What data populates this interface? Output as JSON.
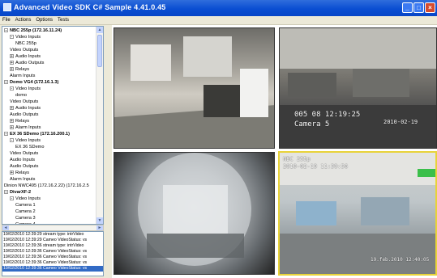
{
  "window": {
    "title": "Advanced Video SDK C# Sample  4.41.0.45",
    "minimize_symbol": "_",
    "maximize_symbol": "□",
    "close_symbol": "×"
  },
  "menu": [
    "File",
    "Actions",
    "Options",
    "Tests"
  ],
  "tree": [
    {
      "label": "NBC 255p (172.16.11.24)",
      "level": 0,
      "expander": "-",
      "bold": true
    },
    {
      "label": "Video Inputs",
      "level": 1,
      "expander": "-"
    },
    {
      "label": "NBC 255p",
      "level": 2,
      "expander": ""
    },
    {
      "label": "Video Outputs",
      "level": 1,
      "expander": ""
    },
    {
      "label": "Audio Inputs",
      "level": 1,
      "expander": "+"
    },
    {
      "label": "Audio Outputs",
      "level": 1,
      "expander": "+"
    },
    {
      "label": "Relays",
      "level": 1,
      "expander": "+"
    },
    {
      "label": "Alarm Inputs",
      "level": 1,
      "expander": ""
    },
    {
      "label": "Domo VG4 (172.16.1.3)",
      "level": 0,
      "expander": "-",
      "bold": true
    },
    {
      "label": "Video Inputs",
      "level": 1,
      "expander": "-"
    },
    {
      "label": "domo",
      "level": 2,
      "expander": ""
    },
    {
      "label": "Video Outputs",
      "level": 1,
      "expander": ""
    },
    {
      "label": "Audio Inputs",
      "level": 1,
      "expander": "+"
    },
    {
      "label": "Audio Outputs",
      "level": 1,
      "expander": ""
    },
    {
      "label": "Relays",
      "level": 1,
      "expander": "+"
    },
    {
      "label": "Alarm Inputs",
      "level": 1,
      "expander": "+"
    },
    {
      "label": "EX 36 SDemo (172.16.200.1)",
      "level": 0,
      "expander": "-",
      "bold": true
    },
    {
      "label": "Video Inputs",
      "level": 1,
      "expander": "-"
    },
    {
      "label": "EX 36 SDemo",
      "level": 2,
      "expander": ""
    },
    {
      "label": "Video Outputs",
      "level": 1,
      "expander": ""
    },
    {
      "label": "Audio Inputs",
      "level": 1,
      "expander": ""
    },
    {
      "label": "Audio Outputs",
      "level": 1,
      "expander": ""
    },
    {
      "label": "Relays",
      "level": 1,
      "expander": "+"
    },
    {
      "label": "Alarm Inputs",
      "level": 1,
      "expander": ""
    },
    {
      "label": "Dinion NWC495 (172.16.2.22) (172.16.2.5",
      "level": 0,
      "expander": ""
    },
    {
      "label": "DivarXF-2",
      "level": 0,
      "expander": "-",
      "bold": true
    },
    {
      "label": "Video Inputs",
      "level": 1,
      "expander": "-"
    },
    {
      "label": "Camera 1",
      "level": 2,
      "expander": ""
    },
    {
      "label": "Camera 2",
      "level": 2,
      "expander": ""
    },
    {
      "label": "Camera 3",
      "level": 2,
      "expander": ""
    },
    {
      "label": "Camera 4",
      "level": 2,
      "expander": ""
    }
  ],
  "log": [
    {
      "text": "19/02/2010 12:39:29 stream type: intrVideo",
      "selected": false
    },
    {
      "text": "19/02/2010 12:39:29 Cameo VideoStatus: vs",
      "selected": false
    },
    {
      "text": "19/02/2010 12:39:36 stream type: intrVideo",
      "selected": false
    },
    {
      "text": "19/02/2010 12:39:36 Cameo VideoStatus: vs",
      "selected": false
    },
    {
      "text": "19/02/2010 12:39:36 Cameo VideoStatus: vs",
      "selected": false
    },
    {
      "text": "19/02/2010 12:39:36 Cameo VideoStatus: vs",
      "selected": false
    },
    {
      "text": "19/02/2010 12:39:36 Cameo VideoStatus: vs",
      "selected": true
    }
  ],
  "video": {
    "tile2_numbers": "005    08   12:19:25",
    "tile2_date": "2010-02-19",
    "tile2_cam": "Camera 5",
    "tile4_name": "NBC 255p",
    "tile4_datetime": "2010-02-19 11:39:56",
    "tile4_stamp": "19.feb.2010   12:40:05"
  },
  "scroll": {
    "up": "▲",
    "down": "▼",
    "left": "◄",
    "right": "►"
  }
}
